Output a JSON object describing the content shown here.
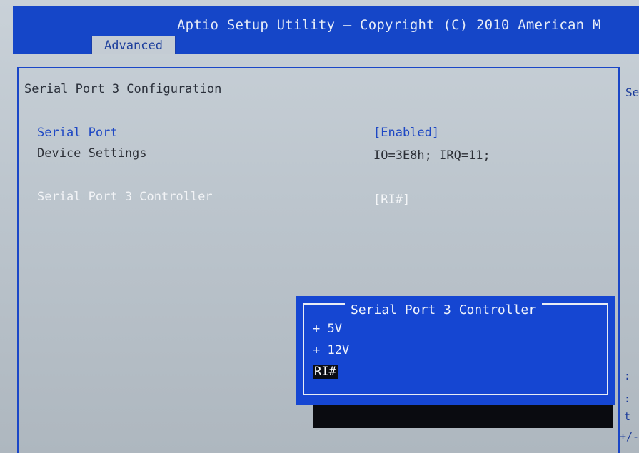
{
  "header": {
    "title": "Aptio Setup Utility – Copyright (C) 2010 American M",
    "active_tab": "Advanced"
  },
  "main": {
    "heading": "Serial Port 3 Configuration",
    "settings": [
      {
        "label": "Serial Port",
        "value": "[Enabled]"
      },
      {
        "label": "Device Settings",
        "value": "IO=3E8h; IRQ=11;"
      },
      {
        "label": "Serial Port 3 Controller",
        "value": "[RI#]"
      }
    ]
  },
  "help_panel": {
    "title_fragment": "Se",
    "fragments": [
      ":",
      ":",
      "t",
      "+/-"
    ]
  },
  "popup": {
    "title": "Serial Port 3 Controller",
    "options": [
      "+ 5V",
      "+ 12V",
      "RI#"
    ],
    "selected": "RI#"
  },
  "colors": {
    "bios_blue": "#1546c8",
    "background": "#c4ccd4",
    "text_dark": "#2c2f36"
  }
}
